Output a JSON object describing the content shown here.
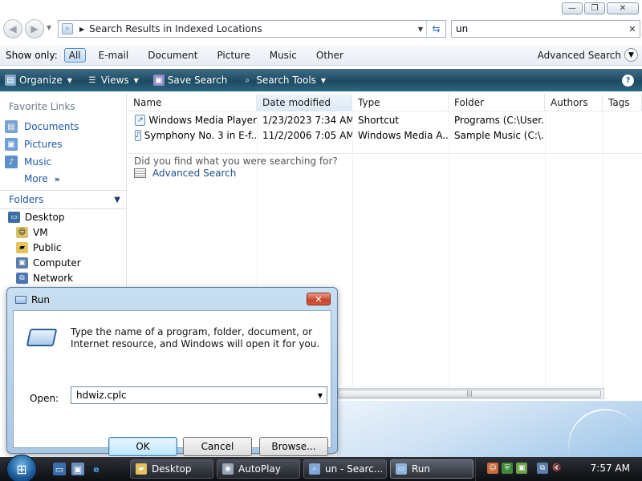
{
  "explorer": {
    "address": {
      "location": "Search Results in Indexed Locations"
    },
    "search": {
      "value": "un"
    },
    "show_only": {
      "label": "Show only:",
      "filters": [
        "All",
        "E-mail",
        "Document",
        "Picture",
        "Music",
        "Other"
      ],
      "selected": "All",
      "advanced_search": "Advanced Search"
    },
    "toolbar": {
      "organize": "Organize",
      "views": "Views",
      "save_search": "Save Search",
      "search_tools": "Search Tools",
      "help_icon": "?"
    },
    "nav": {
      "favorites_title": "Favorite Links",
      "favorites": [
        "Documents",
        "Pictures",
        "Music",
        "More"
      ],
      "folders_title": "Folders",
      "tree": [
        "Desktop",
        "VM",
        "Public",
        "Computer",
        "Network"
      ]
    },
    "columns": [
      "Name",
      "Date modified",
      "Type",
      "Folder",
      "Authors",
      "Tags"
    ],
    "sorted_column": "Date modified",
    "rows": [
      {
        "name": "Windows Media Player",
        "date": "1/23/2023 7:34 AM",
        "type": "Shortcut",
        "folder": "Programs (C:\\User...",
        "icon": "shortcut-icon"
      },
      {
        "name": "Symphony No. 3 in E-f...",
        "date": "11/2/2006 7:05 AM",
        "type": "Windows Media A...",
        "folder": "Sample Music (C:\\...",
        "icon": "music-file-icon"
      }
    ],
    "did_you_find": "Did you find what you were searching for?",
    "advanced_search_link": "Advanced Search"
  },
  "run": {
    "title": "Run",
    "description": "Type the name of a program, folder, document, or Internet resource, and Windows will open it for you.",
    "open_label": "Open:",
    "open_value": "hdwiz.cplc",
    "ok": "OK",
    "cancel": "Cancel",
    "browse": "Browse..."
  },
  "taskbar": {
    "buttons": [
      "Desktop",
      "AutoPlay",
      "un - Searc...",
      "Run"
    ],
    "active": "Run",
    "clock": "7:57 AM"
  },
  "colors": {
    "toolbar": "#1d4a61",
    "link": "#1e5aa8",
    "close_red": "#c7442b",
    "taskbar": "#0d0f13"
  }
}
